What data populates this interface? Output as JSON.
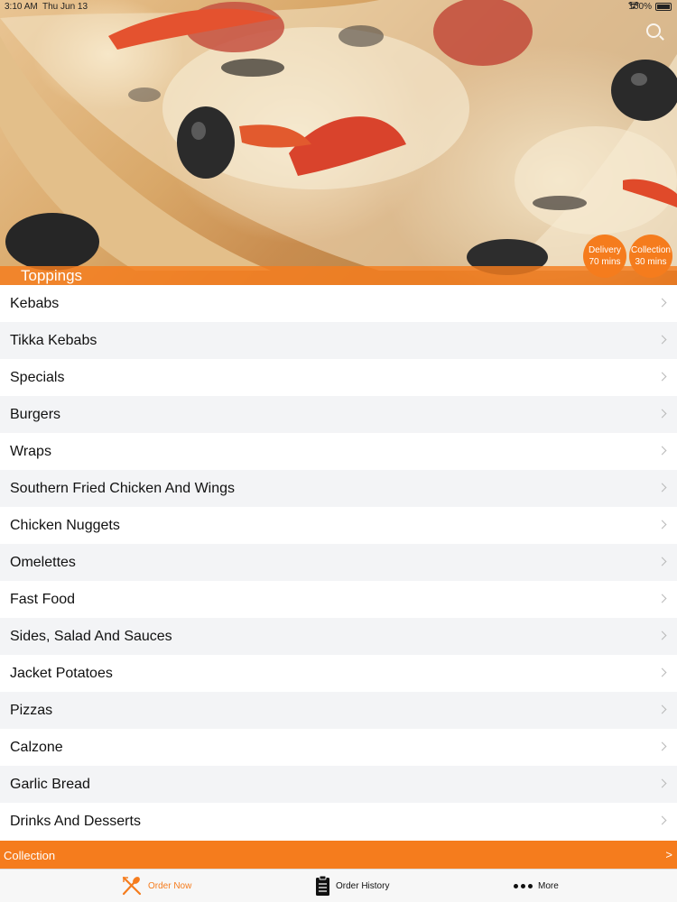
{
  "status_bar": {
    "time": "3:10 AM",
    "date": "Thu Jun 13",
    "battery": "100%"
  },
  "hero": {
    "section_title": "Toppings",
    "delivery": {
      "label": "Delivery",
      "time": "70 mins"
    },
    "collection": {
      "label": "Collection",
      "time": "30 mins"
    }
  },
  "menu": {
    "items": [
      {
        "label": "Kebabs"
      },
      {
        "label": "Tikka Kebabs"
      },
      {
        "label": "Specials"
      },
      {
        "label": "Burgers"
      },
      {
        "label": "Wraps"
      },
      {
        "label": "Southern Fried Chicken And Wings"
      },
      {
        "label": "Chicken Nuggets"
      },
      {
        "label": "Omelettes"
      },
      {
        "label": "Fast Food"
      },
      {
        "label": "Sides, Salad And Sauces"
      },
      {
        "label": "Jacket Potatoes"
      },
      {
        "label": "Pizzas"
      },
      {
        "label": "Calzone"
      },
      {
        "label": "Garlic Bread"
      },
      {
        "label": "Drinks And Desserts"
      }
    ]
  },
  "collection_bar": {
    "label": "Collection",
    "arrow": ">"
  },
  "tab_bar": {
    "tabs": [
      {
        "label": "Order Now",
        "icon": "fork-spoon-icon",
        "active": true
      },
      {
        "label": "Order History",
        "icon": "clipboard-icon",
        "active": false
      },
      {
        "label": "More",
        "icon": "more-dots-icon",
        "active": false
      }
    ]
  },
  "colors": {
    "accent": "#f57c1d",
    "row_alt": "#f3f4f6",
    "tab_bar_bg": "#f7f7f7"
  }
}
